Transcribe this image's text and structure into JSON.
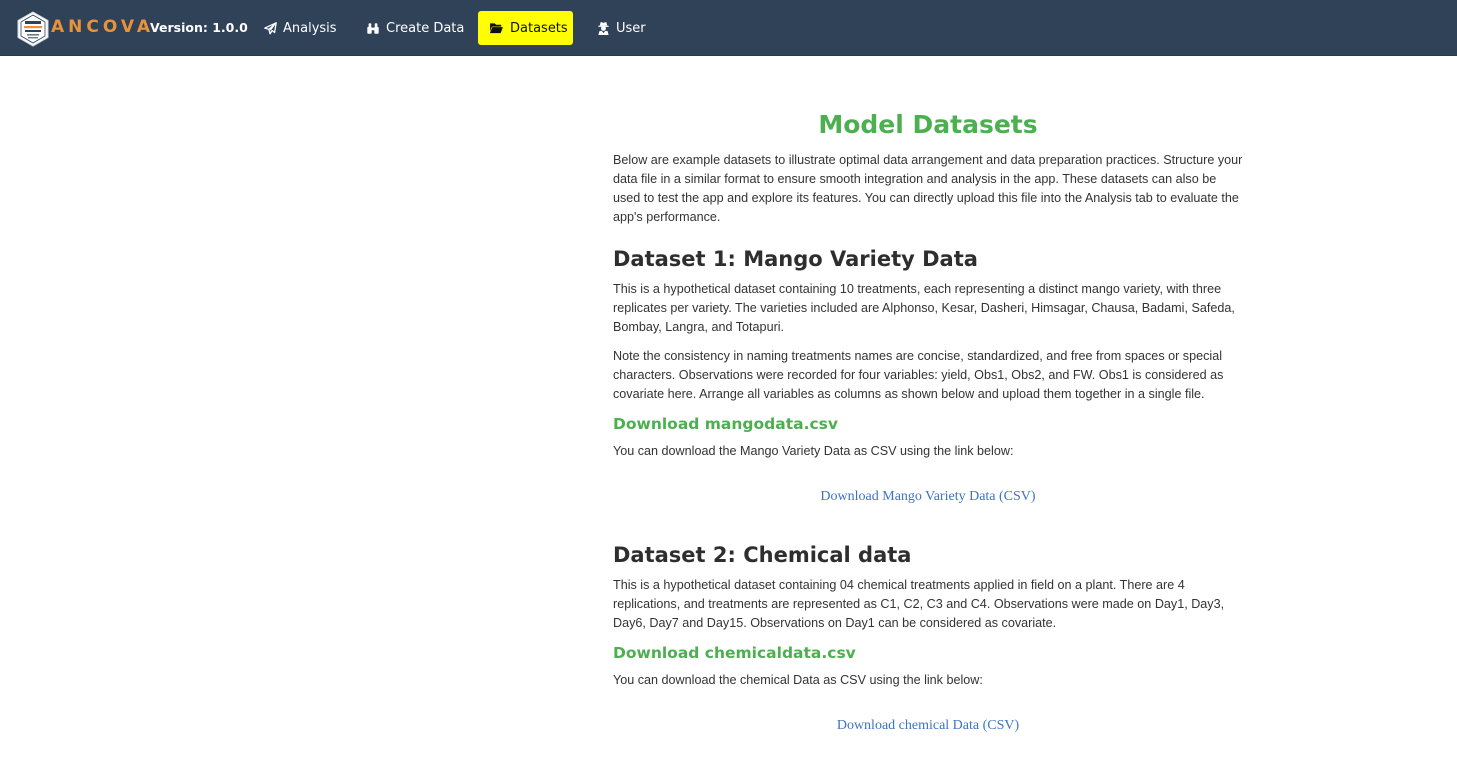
{
  "header": {
    "brand": "ANCOVA",
    "version": "Version: 1.0.0",
    "nav": [
      {
        "label": "Analysis",
        "icon": "paper-plane-icon"
      },
      {
        "label": "Create Data",
        "icon": "binoculars-icon"
      },
      {
        "label": "Datasets",
        "icon": "folder-open-icon",
        "active": true
      },
      {
        "label": "User",
        "icon": "user-secret-icon"
      }
    ],
    "colors": {
      "bar": "#2f4258",
      "brand": "#e8923a",
      "active_tab": "#ffff00"
    }
  },
  "main": {
    "title": "Model Datasets",
    "intro": "Below are example datasets to illustrate optimal data arrangement and data preparation practices. Structure your data file in a similar format to ensure smooth integration and analysis in the app. These datasets can also be used to test the app and explore its features. You can directly upload this file into the Analysis tab to evaluate the app's performance.",
    "datasets": [
      {
        "heading": "Dataset 1: Mango Variety Data",
        "paragraphs": [
          "This is a hypothetical dataset containing 10 treatments, each representing a distinct mango variety, with three replicates per variety. The varieties included are Alphonso, Kesar, Dasheri, Himsagar, Chausa, Badami, Safeda, Bombay, Langra, and Totapuri.",
          "Note the consistency in naming treatments names are concise, standardized, and free from spaces or special characters. Observations were recorded for four variables: yield, Obs1, Obs2, and FW. Obs1 is considered as covariate here. Arrange all variables as columns as shown below and upload them together in a single file."
        ],
        "download_title": "Download mangodata.csv",
        "download_text": "You can download the Mango Variety Data as CSV using the link below:",
        "link_label": "Download Mango Variety Data (CSV)"
      },
      {
        "heading": "Dataset 2: Chemical data",
        "paragraphs": [
          "This is a hypothetical dataset containing 04 chemical treatments applied in field on a plant. There are 4 replications, and treatments are represented as C1, C2, C3 and C4. Observations were made on Day1, Day3, Day6, Day7 and Day15. Observations on Day1 can be considered as covariate."
        ],
        "download_title": "Download chemicaldata.csv",
        "download_text": "You can download the chemical Data as CSV using the link below:",
        "link_label": "Download chemical Data (CSV)"
      }
    ],
    "colors": {
      "title": "#4caf50",
      "link": "#3c73c4"
    }
  }
}
